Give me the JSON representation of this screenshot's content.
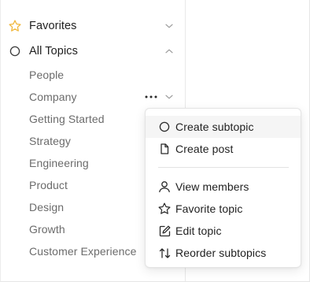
{
  "sidebar": {
    "favorites": {
      "label": "Favorites",
      "icon": "star-icon",
      "accent": "#f0b63a"
    },
    "all_topics": {
      "label": "All Topics",
      "icon": "circle-icon"
    },
    "topics": [
      "People",
      "Company",
      "Getting Started",
      "Strategy",
      "Engineering",
      "Product",
      "Design",
      "Growth",
      "Customer Experience"
    ]
  },
  "context_menu": {
    "items": [
      {
        "label": "Create subtopic",
        "icon": "circle-icon"
      },
      {
        "label": "Create post",
        "icon": "document-icon"
      },
      {
        "label": "View members",
        "icon": "person-icon"
      },
      {
        "label": "Favorite topic",
        "icon": "star-icon"
      },
      {
        "label": "Edit topic",
        "icon": "edit-icon"
      },
      {
        "label": "Reorder subtopics",
        "icon": "reorder-icon"
      }
    ]
  }
}
